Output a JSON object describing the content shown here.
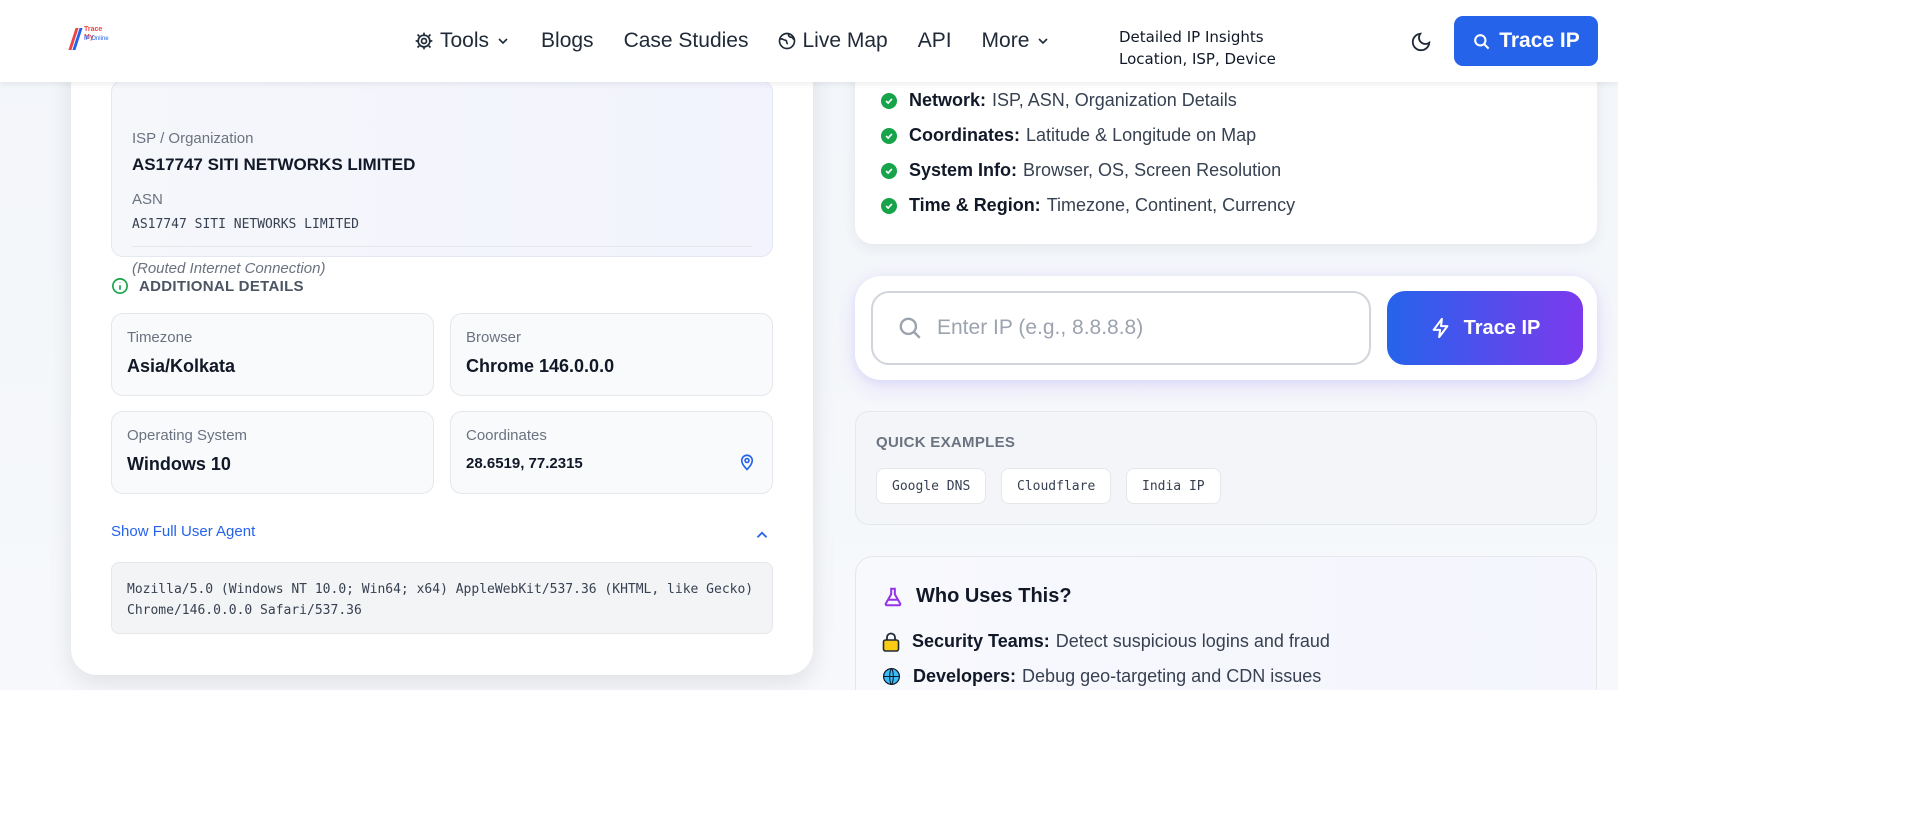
{
  "header": {
    "logo_line1": "Trace My",
    "logo_line2": "IP Online",
    "nav": {
      "tools": "Tools",
      "blogs": "Blogs",
      "case_studies": "Case Studies",
      "live_map": "Live Map",
      "api": "API",
      "more": "More"
    },
    "tooltip_line1": "Detailed IP Insights",
    "tooltip_line2": "Location, ISP, Device",
    "trace_button": "Trace IP"
  },
  "isp": {
    "org_label": "ISP / Organization",
    "org_value": "AS17747 SITI NETWORKS LIMITED",
    "asn_label": "ASN",
    "asn_value": "AS17747 SITI NETWORKS LIMITED",
    "connection": "(Routed Internet Connection)"
  },
  "additional": {
    "title": "ADDITIONAL DETAILS",
    "timezone_label": "Timezone",
    "timezone_value": "Asia/Kolkata",
    "browser_label": "Browser",
    "browser_value": "Chrome 146.0.0.0",
    "os_label": "Operating System",
    "os_value": "Windows 10",
    "coords_label": "Coordinates",
    "coords_value": "28.6519, 77.2315"
  },
  "user_agent": {
    "toggle_label": "Show Full User Agent",
    "value": "Mozilla/5.0 (Windows NT 10.0; Win64; x64) AppleWebKit/537.36 (KHTML, like Gecko) Chrome/146.0.0.0 Safari/537.36"
  },
  "features": [
    {
      "title": "Network:",
      "desc": "ISP, ASN, Organization Details"
    },
    {
      "title": "Coordinates:",
      "desc": "Latitude & Longitude on Map"
    },
    {
      "title": "System Info:",
      "desc": "Browser, OS, Screen Resolution"
    },
    {
      "title": "Time & Region:",
      "desc": "Timezone, Continent, Currency"
    }
  ],
  "search": {
    "placeholder": "Enter IP (e.g., 8.8.8.8)",
    "button": "Trace IP"
  },
  "quick": {
    "title": "QUICK EXAMPLES",
    "chips": [
      "Google DNS",
      "Cloudflare",
      "India IP"
    ]
  },
  "who": {
    "title": "Who Uses This?",
    "items": [
      {
        "title": "Security Teams:",
        "desc": "Detect suspicious logins and fraud"
      },
      {
        "title": "Developers:",
        "desc": "Debug geo-targeting and CDN issues"
      }
    ]
  },
  "colors": {
    "primary": "#2563eb",
    "accent_purple": "#7c3aed",
    "success": "#16a34a"
  }
}
